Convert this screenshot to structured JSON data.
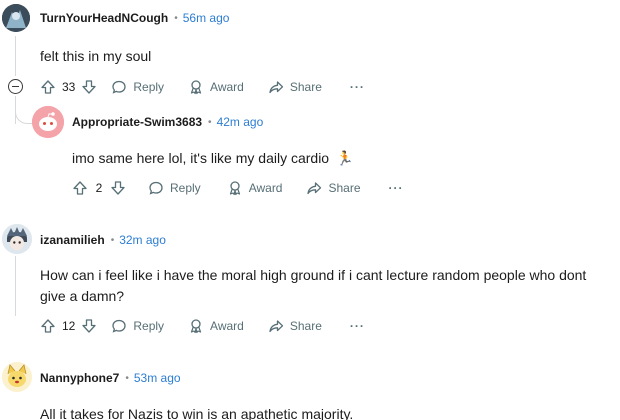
{
  "comments": [
    {
      "author": "TurnYourHeadNCough",
      "separator": "•",
      "time": "56m ago",
      "body": "felt this in my soul",
      "votes": "33",
      "reply_label": "Reply",
      "award_label": "Award",
      "share_label": "Share",
      "more_label": "···"
    },
    {
      "author": "Appropriate-Swim3683",
      "separator": "•",
      "time": "42m ago",
      "body": "imo same here lol, it's like my daily cardio",
      "emoji": "🏃",
      "votes": "2",
      "reply_label": "Reply",
      "award_label": "Award",
      "share_label": "Share",
      "more_label": "···"
    },
    {
      "author": "izanamilieh",
      "separator": "•",
      "time": "32m ago",
      "body": "How can i feel like i have the moral high ground if i cant lecture random people who dont give a damn?",
      "votes": "12",
      "reply_label": "Reply",
      "award_label": "Award",
      "share_label": "Share",
      "more_label": "···"
    },
    {
      "author": "Nannyphone7",
      "separator": "•",
      "time": "53m ago",
      "body": "All it takes for Nazis to win is an apathetic majority."
    }
  ],
  "icons": {
    "upvote": "upvote-icon",
    "downvote": "downvote-icon",
    "reply": "reply-icon",
    "award": "award-icon",
    "share": "share-icon",
    "collapse": "collapse-icon"
  },
  "colors": {
    "time": "#2d7dd2",
    "action": "#576f76",
    "thread_line": "#d7dadc",
    "snoo_avatar_bg": "#f4a3a9"
  }
}
